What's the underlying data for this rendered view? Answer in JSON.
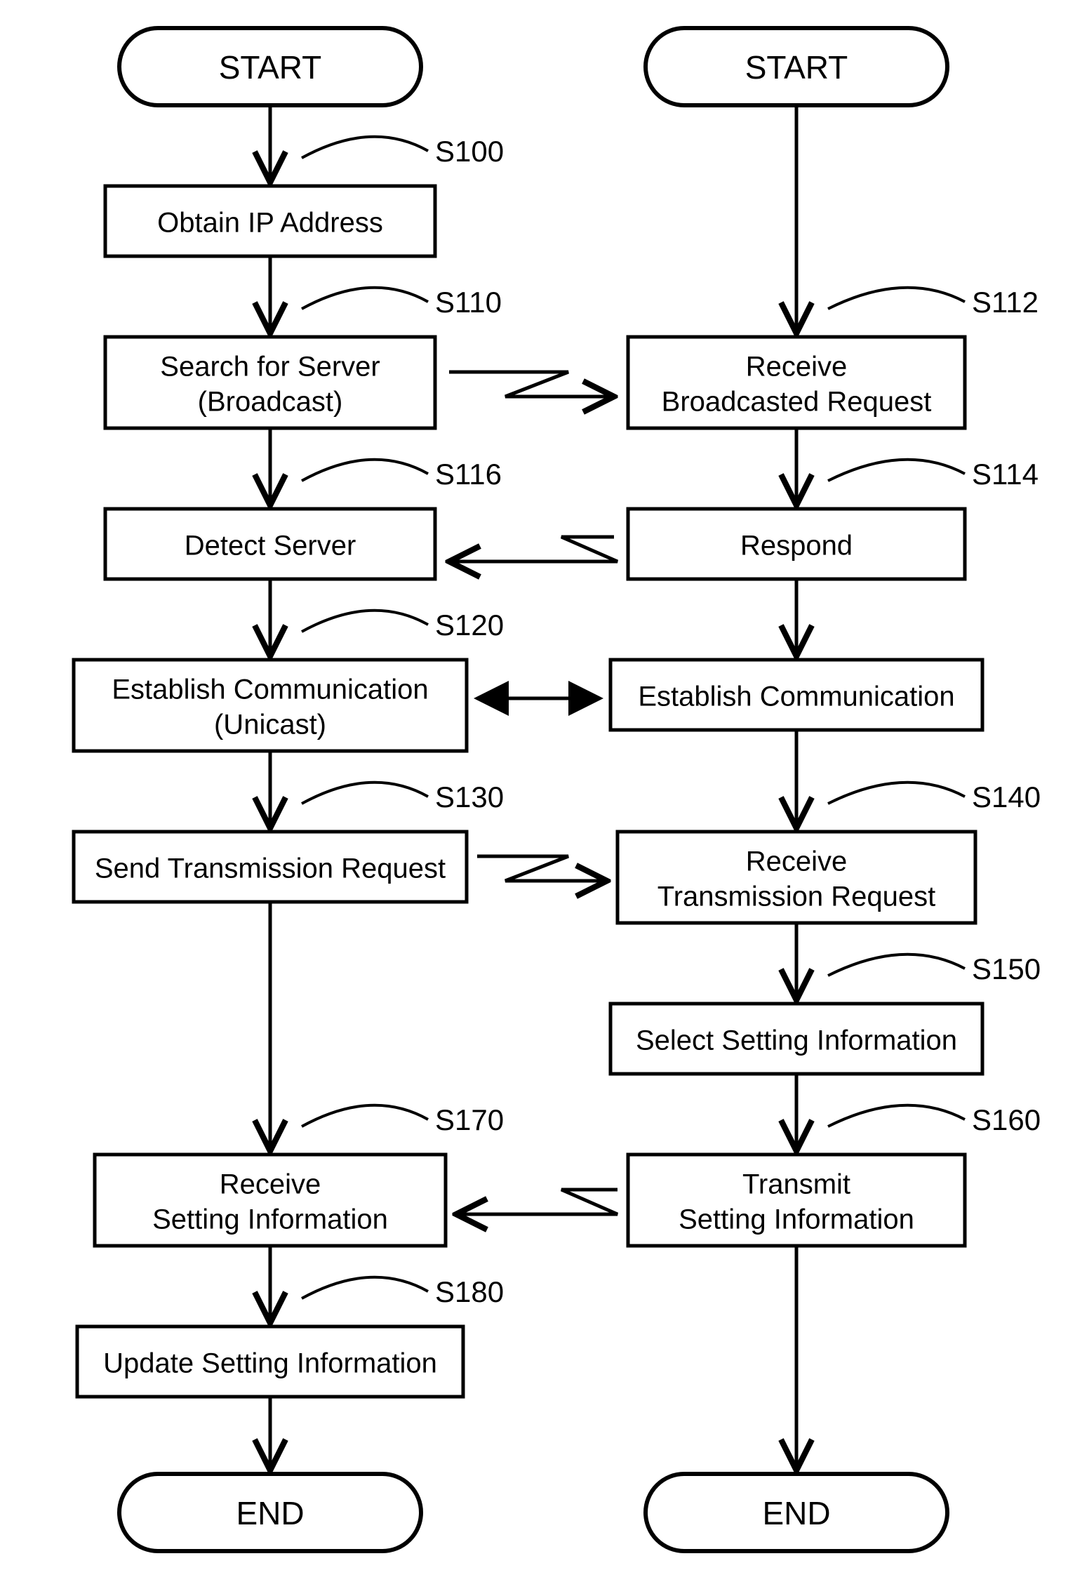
{
  "left": {
    "start": "START",
    "s100": {
      "label": "S100",
      "text": "Obtain IP Address"
    },
    "s110": {
      "label": "S110",
      "line1": "Search for Server",
      "line2": "(Broadcast)"
    },
    "s116": {
      "label": "S116",
      "text": "Detect Server"
    },
    "s120": {
      "label": "S120",
      "line1": "Establish Communication",
      "line2": "(Unicast)"
    },
    "s130": {
      "label": "S130",
      "text": "Send Transmission Request"
    },
    "s170": {
      "label": "S170",
      "line1": "Receive",
      "line2": "Setting Information"
    },
    "s180": {
      "label": "S180",
      "text": "Update Setting Information"
    },
    "end": "END"
  },
  "right": {
    "start": "START",
    "s112": {
      "label": "S112",
      "line1": "Receive",
      "line2": "Broadcasted Request"
    },
    "s114": {
      "label": "S114",
      "text": "Respond"
    },
    "s120r": {
      "text": "Establish Communication"
    },
    "s140": {
      "label": "S140",
      "line1": "Receive",
      "line2": "Transmission Request"
    },
    "s150": {
      "label": "S150",
      "text": "Select Setting Information"
    },
    "s160": {
      "label": "S160",
      "line1": "Transmit",
      "line2": "Setting Information"
    },
    "end": "END"
  }
}
